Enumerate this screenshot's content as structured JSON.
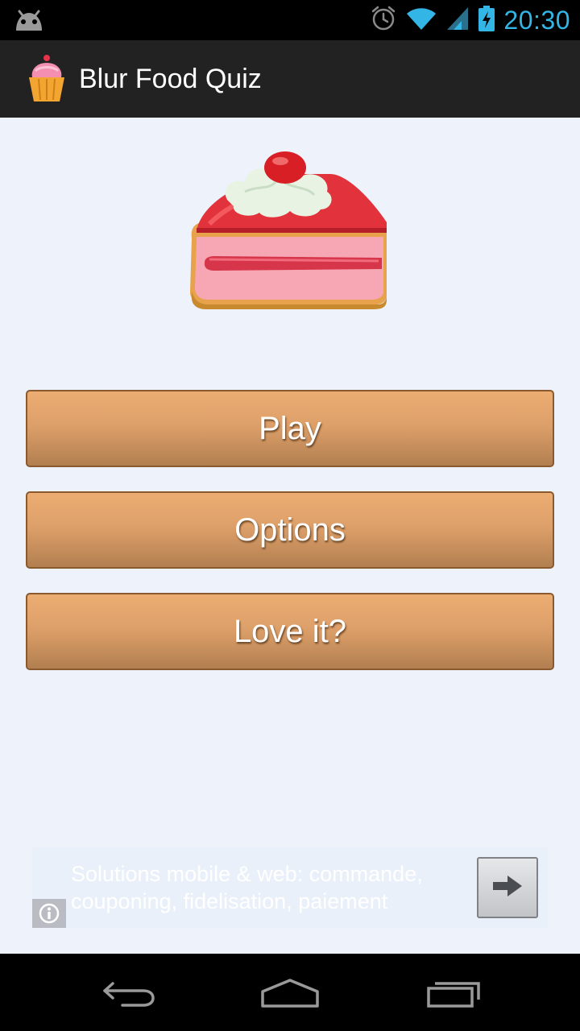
{
  "status_bar": {
    "time": "20:30",
    "icons": [
      "android-notification-icon",
      "alarm-icon",
      "wifi-icon",
      "signal-icon",
      "battery-charging-icon"
    ]
  },
  "action_bar": {
    "title": "Blur Food Quiz",
    "icon": "cupcake-icon"
  },
  "hero": {
    "icon": "cake-slice-icon"
  },
  "menu": {
    "play_label": "Play",
    "options_label": "Options",
    "love_label": "Love it?"
  },
  "ad": {
    "text_line1": "Solutions mobile & web: commande,",
    "text_line2": "couponing, fidelisation, paiement",
    "info_icon": "info-icon",
    "arrow_icon": "arrow-right-icon"
  },
  "nav_bar": {
    "icons": [
      "back-icon",
      "home-icon",
      "recents-icon"
    ]
  },
  "colors": {
    "status_time": "#33b5e5",
    "action_bar_bg": "#222222",
    "page_bg": "#edf2fb",
    "button_top": "#ecad72",
    "button_bottom": "#b27f50",
    "button_border": "#8a5a2e"
  }
}
